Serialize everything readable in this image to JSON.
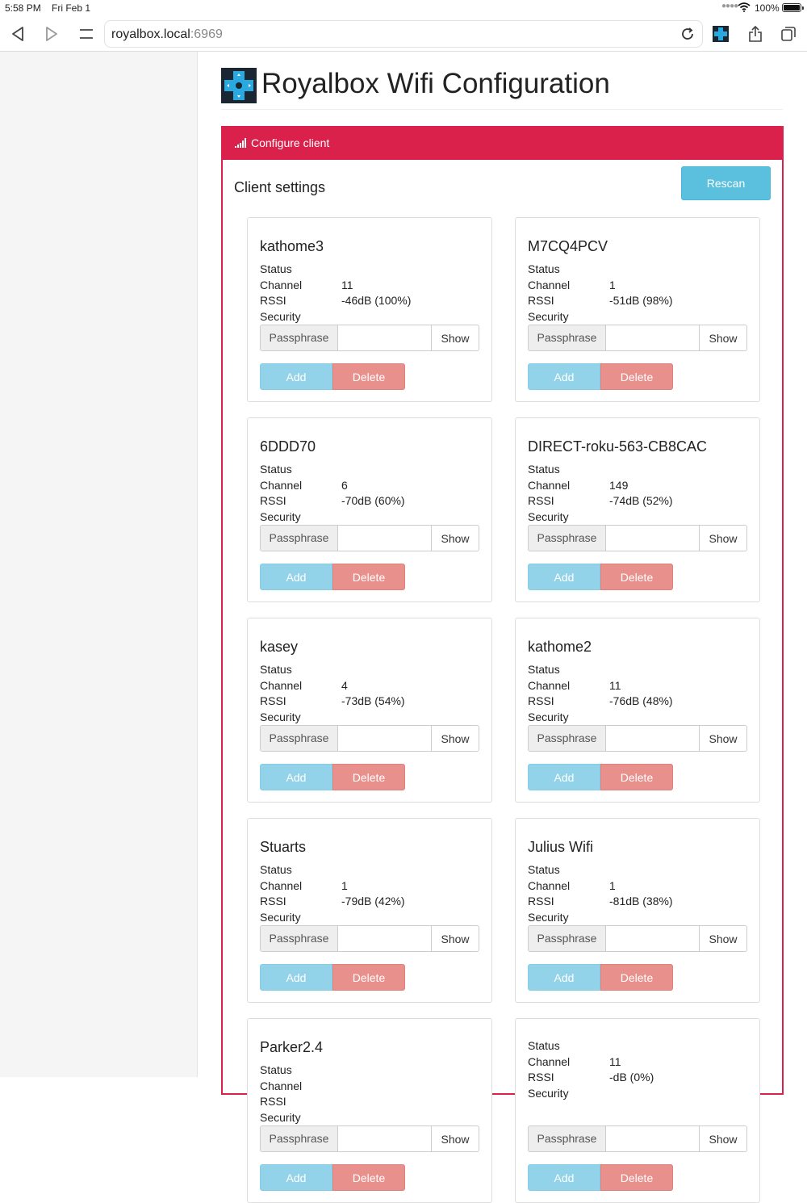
{
  "status_bar": {
    "time": "5:58 PM",
    "date": "Fri Feb 1",
    "battery": "100%"
  },
  "browser": {
    "url_host": "royalbox.local",
    "url_port": ":6969"
  },
  "page": {
    "title": "Royalbox Wifi Configuration"
  },
  "panel": {
    "heading": "Configure client",
    "client_settings": "Client settings",
    "rescan_label": "Rescan"
  },
  "labels": {
    "status": "Status",
    "channel": "Channel",
    "rssi": "RSSI",
    "security": "Security",
    "passphrase": "Passphrase",
    "show": "Show",
    "add": "Add",
    "delete": "Delete"
  },
  "networks": [
    {
      "ssid": "kathome3",
      "channel": "11",
      "rssi": "-46dB (100%)"
    },
    {
      "ssid": "M7CQ4PCV",
      "channel": "1",
      "rssi": "-51dB (98%)"
    },
    {
      "ssid": "6DDD70",
      "channel": "6",
      "rssi": "-70dB (60%)"
    },
    {
      "ssid": "DIRECT-roku-563-CB8CAC",
      "channel": "149",
      "rssi": "-74dB (52%)"
    },
    {
      "ssid": "kasey",
      "channel": "4",
      "rssi": "-73dB (54%)"
    },
    {
      "ssid": "kathome2",
      "channel": "11",
      "rssi": "-76dB (48%)"
    },
    {
      "ssid": "Stuarts",
      "channel": "1",
      "rssi": "-79dB (42%)"
    },
    {
      "ssid": "Julius Wifi",
      "channel": "1",
      "rssi": "-81dB (38%)"
    },
    {
      "ssid": "Parker2.4",
      "channel": "",
      "rssi": ""
    },
    {
      "ssid": "",
      "channel": "11",
      "rssi": "-dB (0%)"
    }
  ],
  "colors": {
    "danger": "#d9214b",
    "info": "#5bc0de",
    "add": "#93d3ea",
    "delete": "#e8908c"
  }
}
